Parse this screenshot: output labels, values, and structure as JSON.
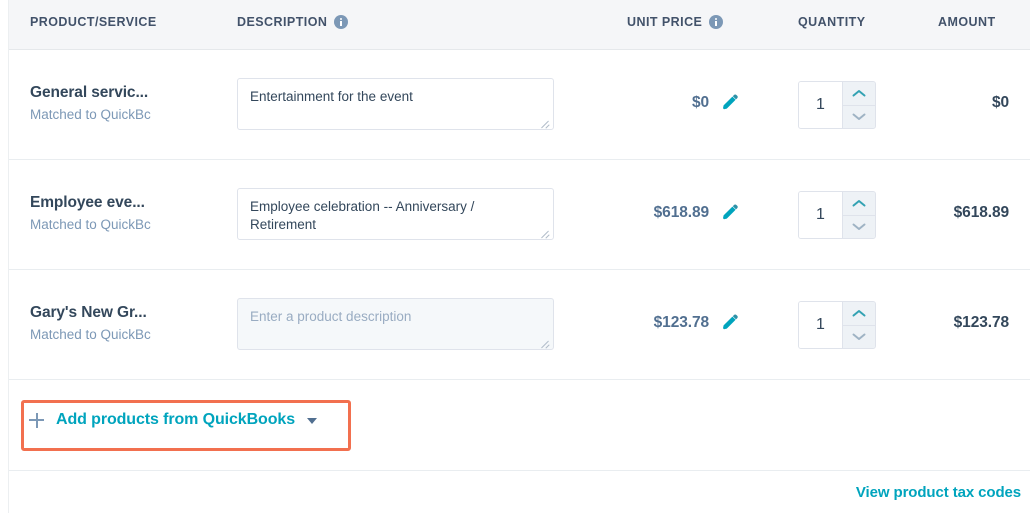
{
  "table": {
    "columns": [
      {
        "key": "product",
        "label": "PRODUCT/SERVICE",
        "info": false
      },
      {
        "key": "description",
        "label": "DESCRIPTION",
        "info": true
      },
      {
        "key": "unit_price",
        "label": "UNIT PRICE",
        "info": true
      },
      {
        "key": "quantity",
        "label": "QUANTITY",
        "info": false
      },
      {
        "key": "amount",
        "label": "AMOUNT",
        "info": false
      }
    ],
    "rows": [
      {
        "product_name": "General servic...",
        "product_sub": "Matched to QuickBc",
        "description_value": "Entertainment for the event",
        "description_placeholder": "Enter a product description",
        "description_filled": true,
        "unit_price": "$0",
        "quantity": "1",
        "amount": "$0"
      },
      {
        "product_name": "Employee eve...",
        "product_sub": "Matched to QuickBc",
        "description_value": "Employee celebration -- Anniversary / Retirement",
        "description_placeholder": "Enter a product description",
        "description_filled": true,
        "unit_price": "$618.89",
        "quantity": "1",
        "amount": "$618.89"
      },
      {
        "product_name": "Gary's New Gr...",
        "product_sub": "Matched to QuickBc",
        "description_value": "",
        "description_placeholder": "Enter a product description",
        "description_filled": false,
        "unit_price": "$123.78",
        "quantity": "1",
        "amount": "$123.78"
      }
    ]
  },
  "add_products": {
    "label": "Add products from QuickBooks",
    "plus_icon": "plus-icon",
    "caret_icon": "chevron-down-icon",
    "highlight_color": "#f2704f"
  },
  "footer": {
    "tax_link": "View product tax codes"
  },
  "icons": {
    "info": "info-icon",
    "edit": "pencil-icon",
    "stepper_up": "chevron-up-icon",
    "stepper_down": "chevron-down-icon",
    "resize": "resize-grip-icon"
  },
  "colors": {
    "link_teal": "#00a4bd",
    "text_dark": "#33475b",
    "text_muted": "#7c98b6",
    "header_bg": "#f5f6f8",
    "border": "#dfe3eb",
    "annotation_orange": "#f2704f"
  }
}
